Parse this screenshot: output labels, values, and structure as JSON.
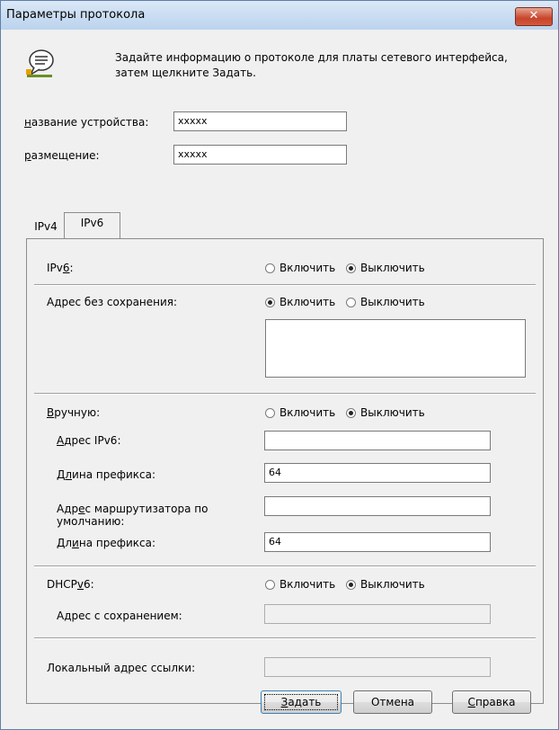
{
  "window": {
    "title": "Параметры протокола",
    "close_label": "✕"
  },
  "intro": {
    "icon": "info-icon",
    "line1": "Задайте информацию о протоколе для платы сетевого интерфейса,",
    "line2": "затем щелкните Задать."
  },
  "device": {
    "name_label": "название устройства:",
    "name_value": "xxxxx",
    "location_label": "размещение:",
    "location_value": "xxxxx"
  },
  "tabs": [
    {
      "label": "IPv4"
    },
    {
      "label": "IPv6"
    }
  ],
  "ipv6": {
    "ipv6_label": "IPv6:",
    "enable_label": "Включить",
    "disable_label": "Выключить",
    "stateless_label": "Адрес без сохранения:",
    "manual_label": "Вручную:",
    "ipv6_address_label": "Адрес IPv6:",
    "prefix_label": "Длина префикса:",
    "prefix_value": "64",
    "gateway_label_1": "Адрес маршрутизатора по",
    "gateway_label_2": "умолчанию:",
    "prefix2_label": "Длина префикса:",
    "prefix2_value": "64",
    "dhcpv6_label": "DHCPv6:",
    "stateful_label": "Адрес с сохранением:",
    "link_local_label": "Локальный адрес ссылки:"
  },
  "buttons": {
    "set": "Задать",
    "cancel": "Отмена",
    "help": "Справка"
  }
}
